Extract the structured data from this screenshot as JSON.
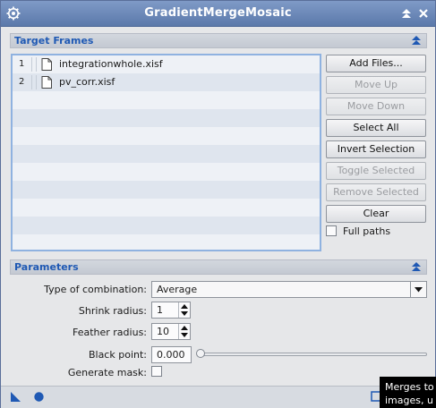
{
  "window": {
    "title": "GradientMergeMosaic"
  },
  "target_frames": {
    "header": "Target Frames",
    "files": [
      {
        "index": "1",
        "name": "integrationwhole.xisf"
      },
      {
        "index": "2",
        "name": "pv_corr.xisf"
      }
    ],
    "buttons": {
      "add_files": "Add Files...",
      "move_up": "Move Up",
      "move_down": "Move Down",
      "select_all": "Select All",
      "invert_selection": "Invert Selection",
      "toggle_selected": "Toggle Selected",
      "remove_selected": "Remove Selected",
      "clear": "Clear"
    },
    "full_paths_label": "Full paths"
  },
  "parameters": {
    "header": "Parameters",
    "type_of_combination_label": "Type of combination:",
    "type_of_combination_value": "Average",
    "shrink_radius_label": "Shrink radius:",
    "shrink_radius_value": "1",
    "feather_radius_label": "Feather radius:",
    "feather_radius_value": "10",
    "black_point_label": "Black point:",
    "black_point_value": "0.000",
    "generate_mask_label": "Generate mask:"
  },
  "tooltip": {
    "line1": "Merges to",
    "line2": "images, u"
  },
  "colors": {
    "title_bar": "#6e8bbb",
    "section_label": "#1f59b4",
    "list_border": "#8fb2e0"
  }
}
